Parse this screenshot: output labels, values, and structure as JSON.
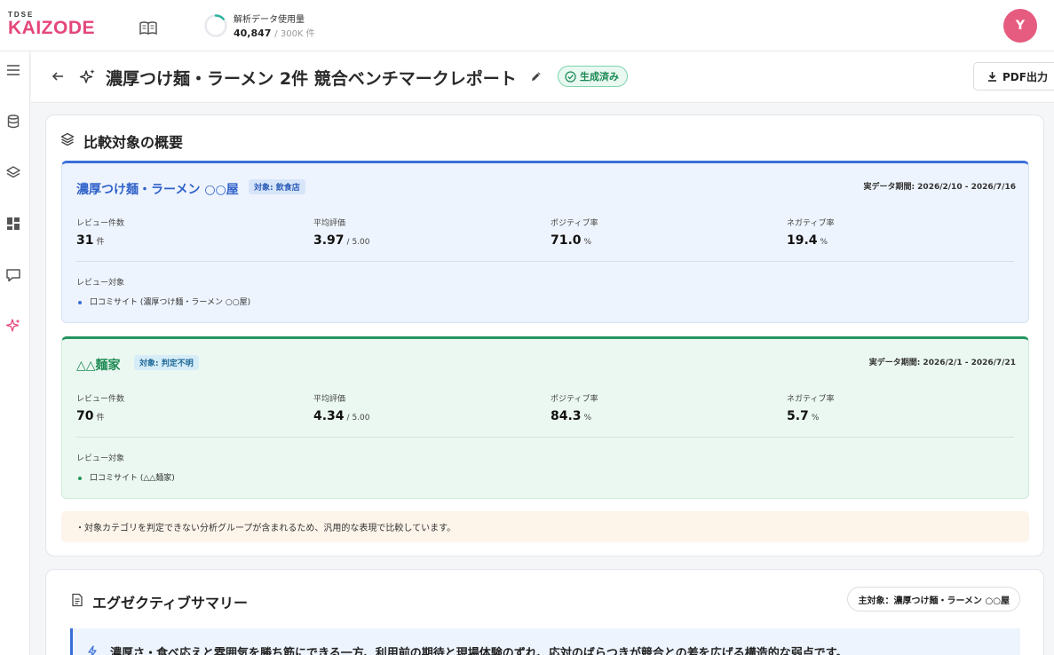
{
  "header": {
    "logo_small": "TDSE",
    "logo_main": "KAIZODE",
    "usage_label": "解析データ使用量",
    "usage_value": "40,847",
    "usage_max": "/ 300K 件",
    "usage_fraction": 0.136,
    "avatar_initial": "Y"
  },
  "titlebar": {
    "title": "濃厚つけ麺・ラーメン 2件 競合ベンチマークレポート",
    "status": "生成済み",
    "pdf_label": "PDF出力"
  },
  "overview": {
    "title": "比較対象の概要",
    "competitors": [
      {
        "name": "濃厚つけ麺・ラーメン ○○屋",
        "tag": "対象: 飲食店",
        "period": "実データ期間: 2026/2/10 - 2026/7/16",
        "metrics": [
          {
            "label": "レビュー件数",
            "value": "31",
            "unit": "件"
          },
          {
            "label": "平均評価",
            "value": "3.97",
            "unit": "/ 5.00"
          },
          {
            "label": "ポジティブ率",
            "value": "71.0",
            "unit": "%"
          },
          {
            "label": "ネガティブ率",
            "value": "19.4",
            "unit": "%"
          }
        ],
        "review_label": "レビュー対象",
        "review_item": "口コミサイト (濃厚つけ麺・ラーメン ○○屋)"
      },
      {
        "name": "△△麺家",
        "tag": "対象: 判定不明",
        "period": "実データ期間: 2026/2/1 - 2026/7/21",
        "metrics": [
          {
            "label": "レビュー件数",
            "value": "70",
            "unit": "件"
          },
          {
            "label": "平均評価",
            "value": "4.34",
            "unit": "/ 5.00"
          },
          {
            "label": "ポジティブ率",
            "value": "84.3",
            "unit": "%"
          },
          {
            "label": "ネガティブ率",
            "value": "5.7",
            "unit": "%"
          }
        ],
        "review_label": "レビュー対象",
        "review_item": "口コミサイト (△△麺家)"
      }
    ],
    "note": "・対象カテゴリを判定できない分析グループが含まれるため、汎用的な表現で比較しています。"
  },
  "exec": {
    "title": "エグゼクティブサマリー",
    "main_target": "主対象：濃厚つけ麺・ラーメン ○○屋",
    "summary": "濃厚さ・食べ応えと雰囲気を勝ち筋にできる一方、利用前の期待と現場体験のずれ、応対のばらつきが競合との差を広げる構造的な弱点です。"
  },
  "colors": {
    "brand": "#e4477a",
    "primary_blue": "#3a6fd8",
    "green": "#23945e",
    "usage_ring": "#2bb3a0"
  }
}
